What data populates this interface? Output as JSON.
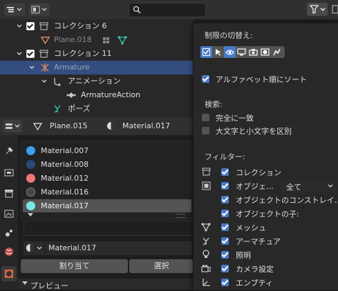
{
  "outliner": {
    "search_placeholder": "",
    "rows": [
      {
        "label": "コレクション 6"
      },
      {
        "label": "Plane.018"
      },
      {
        "label": "コレクション 11"
      },
      {
        "label": "Armature"
      },
      {
        "label": "アニメーション"
      },
      {
        "label": "ArmatureAction"
      },
      {
        "label": "ポーズ"
      }
    ]
  },
  "properties": {
    "object_name": "Plane.015",
    "material_name": "Material.017",
    "materials": [
      {
        "label": "Material.007",
        "color": "#3aa0f0"
      },
      {
        "label": "Material.008",
        "color": "#2a4a78"
      },
      {
        "label": "Material.012",
        "color": "#f07878"
      },
      {
        "label": "Material.016",
        "color": "#444444"
      },
      {
        "label": "Material.017",
        "color": "#78e8e8"
      }
    ],
    "slot_material": "Material.017",
    "assign_label": "割り当て",
    "select_label": "選択",
    "preview_label": "プレビュー"
  },
  "filter_popover": {
    "restriction_title": "制限の切替え:",
    "sort_alpha_label": "アルファベット順にソート",
    "search_title": "検索:",
    "exact_match_label": "完全に一致",
    "case_sensitive_label": "大文字と小文字を区別",
    "filter_title": "フィルター:",
    "filters": [
      {
        "label": "コレクション"
      },
      {
        "label": "オブジェ…"
      },
      {
        "label": "オブジェクトのコンストレイ…"
      },
      {
        "label": "オブジェクトの子:"
      },
      {
        "label": "メッシュ"
      },
      {
        "label": "アーマチュア"
      },
      {
        "label": "照明"
      },
      {
        "label": "カメラ設定"
      },
      {
        "label": "エンプティ"
      }
    ],
    "object_filter_value": "全て"
  },
  "colors": {
    "accent": "#4a7bc6",
    "selected_row": "#334d80"
  }
}
